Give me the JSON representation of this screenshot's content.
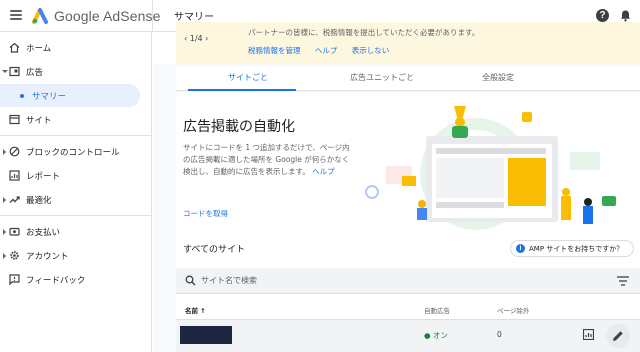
{
  "app": {
    "brand": "Google AdSense",
    "page_title": "サマリー"
  },
  "sidebar": {
    "items": [
      {
        "label": "ホーム",
        "icon": "home-icon"
      },
      {
        "label": "広告",
        "icon": "ads-icon"
      },
      {
        "label": "サマリー",
        "icon": "dot-icon",
        "active": true
      },
      {
        "label": "サイト",
        "icon": "sites-icon"
      },
      {
        "label": "ブロックのコントロール",
        "icon": "block-icon"
      },
      {
        "label": "レポート",
        "icon": "reports-icon"
      },
      {
        "label": "最適化",
        "icon": "optimize-icon"
      },
      {
        "label": "お支払い",
        "icon": "payments-icon"
      },
      {
        "label": "アカウント",
        "icon": "gear-icon"
      },
      {
        "label": "フィードバック",
        "icon": "feedback-icon"
      }
    ]
  },
  "banner": {
    "pager": "1/4",
    "message": "パートナーの皆様に、税務情報を提出していただく必要があります。",
    "links": [
      "税務情報を管理",
      "ヘルプ",
      "表示しない"
    ]
  },
  "tabs": [
    {
      "label": "サイトごと",
      "active": true
    },
    {
      "label": "広告ユニットごと",
      "active": false
    },
    {
      "label": "全般設定",
      "active": false
    }
  ],
  "hero": {
    "title": "広告掲載の自動化",
    "description": "サイトにコードを 1 つ追加するだけで、ページ内の広告掲載に適した場所を Google が何らかなく検出し、自動的に広告を表示します。",
    "help_link": "ヘルプ",
    "code_button": "コードを取得"
  },
  "sites": {
    "title": "すべてのサイト",
    "amp_chip": "AMP サイトをお持ちですか？",
    "search_placeholder": "サイト名で検索",
    "columns": [
      "名前",
      "自動広告",
      "ページ除外"
    ],
    "rows": [
      {
        "name": "",
        "auto_ads": "● オン",
        "page_exclusions": "0"
      }
    ]
  },
  "colors": {
    "accent": "#1a73e8",
    "banner": "#fef7e0",
    "status_on": "#188038"
  }
}
